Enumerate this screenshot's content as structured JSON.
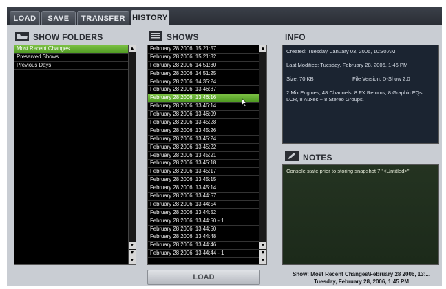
{
  "tabs": [
    {
      "label": "LOAD"
    },
    {
      "label": "SAVE"
    },
    {
      "label": "TRANSFER"
    },
    {
      "label": "HISTORY"
    }
  ],
  "folders": {
    "title": "SHOW FOLDERS",
    "items": [
      {
        "label": "Most Recent Changes",
        "selected": true
      },
      {
        "label": "Preserved Shows"
      },
      {
        "label": "Previous Days"
      }
    ]
  },
  "shows": {
    "title": "SHOWS",
    "items": [
      {
        "label": "February 28 2006, 15:21:57"
      },
      {
        "label": "February 28 2006, 15:21:32"
      },
      {
        "label": "February 28 2006, 14:51:30"
      },
      {
        "label": "February 28 2006, 14:51:25"
      },
      {
        "label": "February 28 2006, 14:35:24"
      },
      {
        "label": "February 28 2006, 13:46:37"
      },
      {
        "label": "February 28 2006, 13:46:16",
        "selected": true
      },
      {
        "label": "February 28 2006, 13:46:14"
      },
      {
        "label": "February 28 2006, 13:46:09"
      },
      {
        "label": "February 28 2006, 13:45:28"
      },
      {
        "label": "February 28 2006, 13:45:26"
      },
      {
        "label": "February 28 2006, 13:45:24"
      },
      {
        "label": "February 28 2006, 13:45:22"
      },
      {
        "label": "February 28 2006, 13:45:21"
      },
      {
        "label": "February 28 2006, 13:45:18"
      },
      {
        "label": "February 28 2006, 13:45:17"
      },
      {
        "label": "February 28 2006, 13:45:15"
      },
      {
        "label": "February 28 2006, 13:45:14"
      },
      {
        "label": "February 28 2006, 13:44:57"
      },
      {
        "label": "February 28 2006, 13:44:54"
      },
      {
        "label": "February 28 2006, 13:44:52"
      },
      {
        "label": "February 28 2006, 13:44:50 - 1"
      },
      {
        "label": "February 28 2006, 13:44:50"
      },
      {
        "label": "February 28 2006, 13:44:48"
      },
      {
        "label": "February 28 2006, 13:44:46"
      },
      {
        "label": "February 28 2006, 13:44:44 - 1"
      }
    ]
  },
  "info": {
    "title": "INFO",
    "created": "Created: Tuesday, January 03, 2006, 10:30 AM",
    "modified": "Last Modified: Tuesday, February 28, 2006, 1:46 PM",
    "size": "Size: 70 KB",
    "version": "File Version: D-Show 2.0",
    "description": "2 Mix Engines, 48 Channels, 8 FX Returns, 8 Graphic EQs, LCR, 8 Auxes + 8 Stereo Groups."
  },
  "notes": {
    "title": "NOTES",
    "text": "Console state prior to storing snapshot 7 \"<Untitled>\""
  },
  "load_button": "LOAD",
  "status": {
    "line1": "Show: Most Recent Changes\\February 28 2006, 13:...",
    "line2": "Tuesday, February 28, 2006, 1:45 PM"
  },
  "colors": {
    "selection": "#5fad2e",
    "list_bg": "#000000",
    "info_bg": "#1b2431",
    "notes_bg": "#22301f",
    "panel_bg": "#c9cdd3"
  }
}
